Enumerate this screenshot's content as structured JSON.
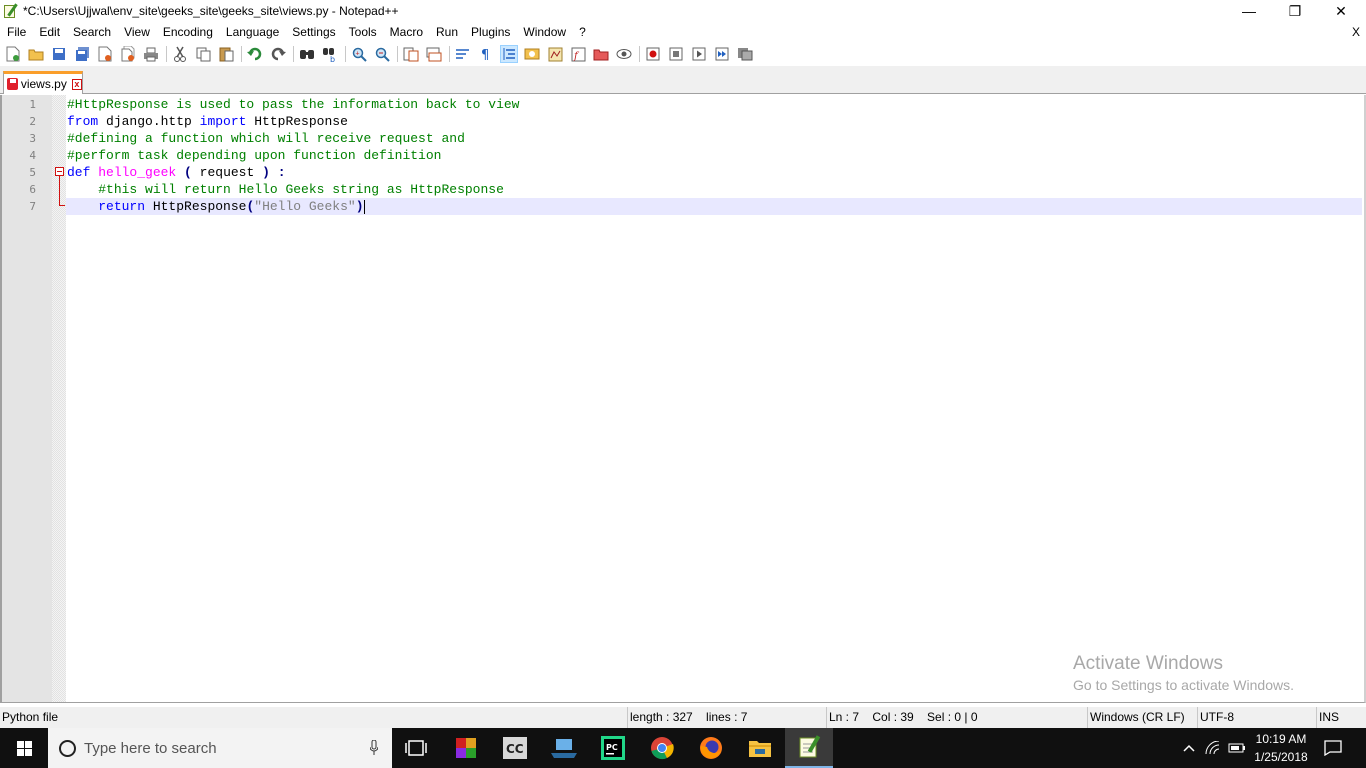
{
  "window": {
    "title": "*C:\\Users\\Ujjwal\\env_site\\geeks_site\\geeks_site\\views.py - Notepad++",
    "minimize_glyph": "—",
    "restore_glyph": "❐",
    "close_glyph": "✕"
  },
  "menu": {
    "items": [
      "File",
      "Edit",
      "Search",
      "View",
      "Encoding",
      "Language",
      "Settings",
      "Tools",
      "Macro",
      "Run",
      "Plugins",
      "Window",
      "?"
    ],
    "close_doc": "X"
  },
  "toolbar": {
    "icons": [
      "new-file-icon",
      "open-file-icon",
      "save-icon",
      "save-all-icon",
      "close-icon",
      "close-all-icon",
      "print-icon",
      "cut-icon",
      "copy-icon",
      "paste-icon",
      "undo-icon",
      "redo-icon",
      "find-icon",
      "replace-icon",
      "zoom-in-icon",
      "zoom-out-icon",
      "sync-vertical-icon",
      "sync-horizontal-icon",
      "word-wrap-icon",
      "show-all-chars-icon",
      "indent-guide-icon",
      "user-language-icon",
      "doc-map-icon",
      "function-list-icon",
      "folder-as-workspace-icon",
      "monitoring-icon",
      "record-macro-icon",
      "stop-record-icon",
      "playback-macro-icon",
      "run-macro-multiple-icon",
      "save-macro-icon"
    ]
  },
  "tab": {
    "label": "views.py",
    "close_glyph": "x"
  },
  "editor": {
    "line_numbers": [
      "1",
      "2",
      "3",
      "4",
      "5",
      "6",
      "7"
    ],
    "lines": [
      [
        {
          "t": "#HttpResponse is used to pass the information back to view",
          "c": "comment"
        }
      ],
      [
        {
          "t": "from",
          "c": "kw"
        },
        {
          "t": " django.http ",
          "c": "def"
        },
        {
          "t": "import",
          "c": "kw"
        },
        {
          "t": " HttpResponse",
          "c": "def"
        }
      ],
      [
        {
          "t": "#defining a function which will receive request and",
          "c": "comment"
        }
      ],
      [
        {
          "t": "#perform task depending upon function definition",
          "c": "comment"
        }
      ],
      [
        {
          "t": "def",
          "c": "kw"
        },
        {
          "t": " ",
          "c": "def"
        },
        {
          "t": "hello_geek",
          "c": "fn"
        },
        {
          "t": " ",
          "c": "def"
        },
        {
          "t": "(",
          "c": "op"
        },
        {
          "t": " request ",
          "c": "def"
        },
        {
          "t": ")",
          "c": "op"
        },
        {
          "t": " ",
          "c": "def"
        },
        {
          "t": ":",
          "c": "op"
        }
      ],
      [
        {
          "t": "    ",
          "c": "def"
        },
        {
          "t": "#this will return Hello Geeks string as HttpResponse",
          "c": "comment"
        }
      ],
      [
        {
          "t": "    ",
          "c": "def"
        },
        {
          "t": "return",
          "c": "kw"
        },
        {
          "t": " HttpResponse",
          "c": "def"
        },
        {
          "t": "(",
          "c": "op"
        },
        {
          "t": "\"Hello Geeks\"",
          "c": "str"
        },
        {
          "t": ")",
          "c": "op"
        }
      ]
    ],
    "current_line": 7
  },
  "watermark": {
    "title": "Activate Windows",
    "subtitle": "Go to Settings to activate Windows."
  },
  "status": {
    "file_type": "Python file",
    "length": "length : 327    lines : 7",
    "position": "Ln : 7    Col : 39    Sel : 0 | 0",
    "eol": "Windows (CR LF)",
    "encoding": "UTF-8",
    "mode": "INS"
  },
  "taskbar": {
    "search_placeholder": "Type here to search",
    "apps": [
      "task-view-icon",
      "winrar-icon",
      "cc-icon",
      "file-transfer-icon",
      "pycharm-icon",
      "chrome-icon",
      "firefox-icon",
      "file-explorer-icon",
      "notepadpp-icon"
    ],
    "active_app": "notepadpp-icon",
    "clock_time": "10:19 AM",
    "clock_date": "1/25/2018"
  },
  "colors": {
    "comment": "#008000",
    "keyword": "#0000ff",
    "function": "#ff00ff",
    "operator": "#000080",
    "string": "#808080",
    "current_line": "#e8e8ff",
    "tab_accent": "#fa9e2a"
  }
}
